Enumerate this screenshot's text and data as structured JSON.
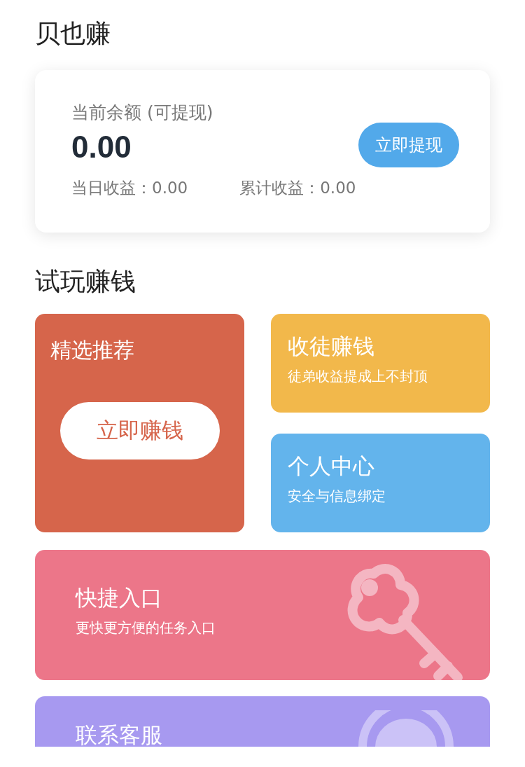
{
  "title": "贝也赚",
  "balance": {
    "label": "当前余额 (可提现)",
    "amount": "0.00",
    "button": "立即提现",
    "stats": [
      {
        "text": "当日收益：0.00"
      },
      {
        "text": "累计收益：0.00"
      }
    ]
  },
  "section_title": "试玩赚钱",
  "featured": {
    "title": "精选推荐",
    "button": "立即赚钱"
  },
  "cards": [
    {
      "title": "收徒赚钱",
      "subtitle": "徒弟收益提成上不封顶",
      "color": "#f2b84b"
    },
    {
      "title": "个人中心",
      "subtitle": "安全与信息绑定",
      "color": "#63b4ec"
    }
  ],
  "shortcut": {
    "title": "快捷入口",
    "subtitle": "更快更方便的任务入口"
  },
  "support": {
    "title": "联系客服"
  }
}
